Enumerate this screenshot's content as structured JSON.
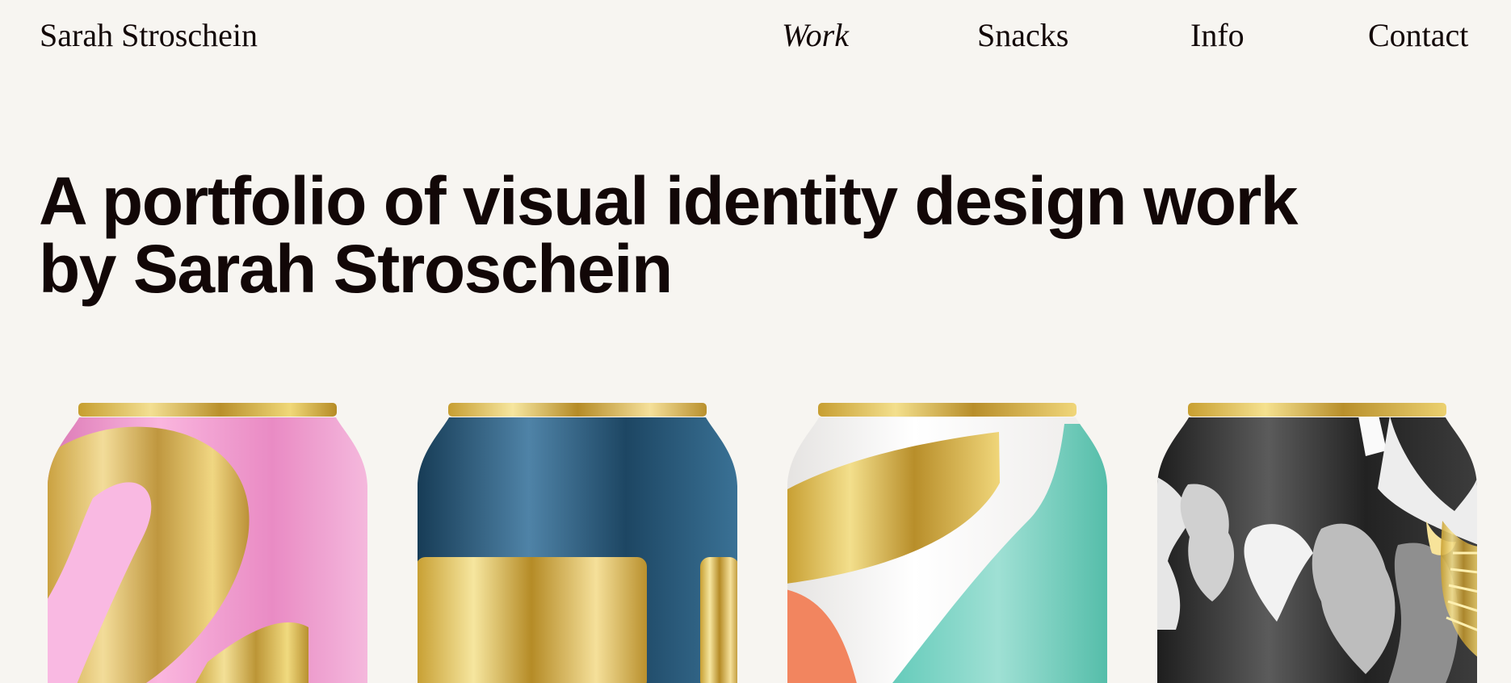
{
  "header": {
    "site_name": "Sarah Stroschein",
    "nav": [
      {
        "label": "Work",
        "active": true
      },
      {
        "label": "Snacks",
        "active": false
      },
      {
        "label": "Info",
        "active": false
      },
      {
        "label": "Contact",
        "active": false
      }
    ]
  },
  "hero": {
    "line1": "A portfolio of visual identity design work",
    "line2": "by Sarah Stroschein"
  },
  "gallery": {
    "items": [
      {
        "semantic": "pink-gold-can-image"
      },
      {
        "semantic": "navy-gold-can-image"
      },
      {
        "semantic": "white-teal-gold-can-image"
      },
      {
        "semantic": "black-gold-can-image"
      }
    ]
  },
  "colors": {
    "background": "#f7f5f1",
    "text": "#120707",
    "gold": "#d8b84e",
    "pink": "#ef8fca",
    "navy": "#173e59",
    "teal": "#67cbbd",
    "coral": "#f28a68",
    "black": "#232323"
  }
}
